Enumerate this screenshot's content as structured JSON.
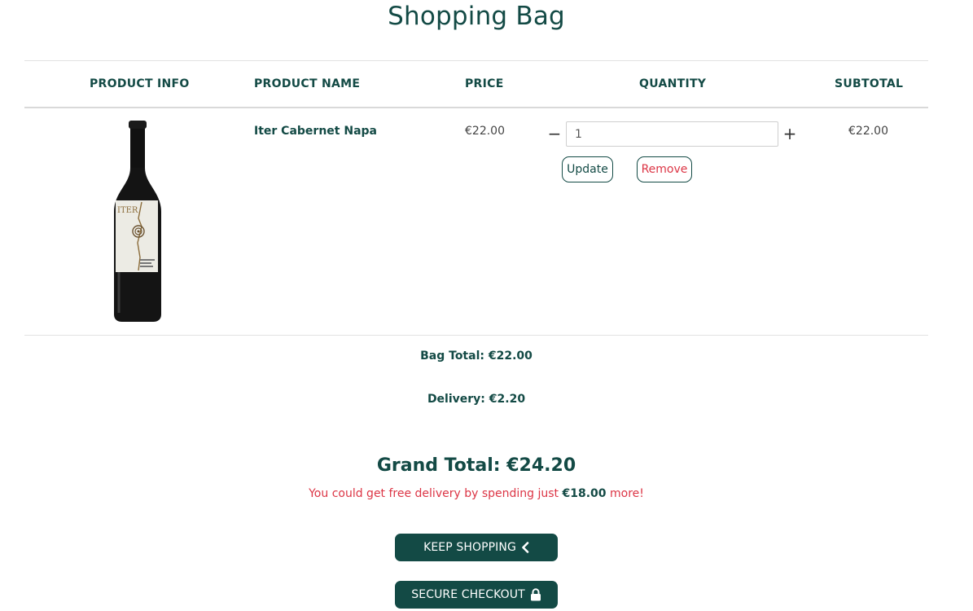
{
  "page": {
    "title": "Shopping Bag"
  },
  "table": {
    "headers": {
      "info": "PRODUCT INFO",
      "name": "PRODUCT NAME",
      "price": "PRICE",
      "quantity": "QUANTITY",
      "subtotal": "SUBTOTAL"
    },
    "rows": [
      {
        "image_icon": "wine-bottle-image",
        "label_text": "ITER",
        "name": "Iter Cabernet Napa",
        "price": "€22.00",
        "quantity_value": "1",
        "minus_label": "−",
        "plus_label": "+",
        "update_label": "Update",
        "remove_label": "Remove",
        "subtotal": "€22.00"
      }
    ]
  },
  "summary": {
    "bag_total": "Bag Total: €22.00",
    "delivery": "Delivery: €2.20",
    "grand_total": "Grand Total: €24.20",
    "free_delivery_prefix": "You could get free delivery by spending just",
    "free_delivery_amount": "€18.00",
    "free_delivery_suffix": "more!"
  },
  "actions": {
    "keep_shopping": "KEEP SHOPPING",
    "keep_shopping_icon": "chevron-left-icon",
    "checkout": "SECURE CHECKOUT",
    "checkout_icon": "lock-icon"
  },
  "colors": {
    "primary": "#134a45",
    "danger": "#dc3545",
    "border": "#e2e2e2"
  }
}
